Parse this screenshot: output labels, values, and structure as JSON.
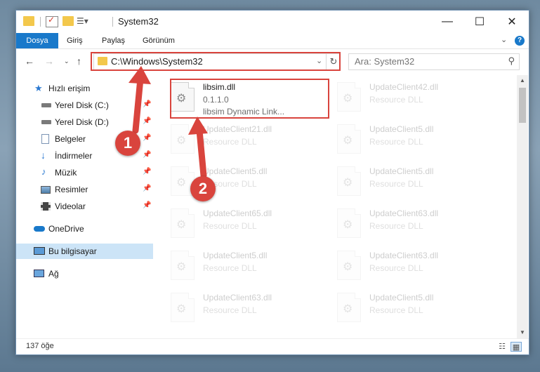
{
  "window": {
    "title": "System32",
    "controls": {
      "minimize": "—",
      "maximize": "☐",
      "close": "✕"
    }
  },
  "ribbon": {
    "tabs": [
      "Dosya",
      "Giriş",
      "Paylaş",
      "Görünüm"
    ],
    "help": "?"
  },
  "address": {
    "path": "C:\\Windows\\System32"
  },
  "search": {
    "placeholder": "Ara: System32"
  },
  "sidebar": {
    "items": [
      {
        "label": "Hızlı erişim",
        "icon": "star-icon"
      },
      {
        "label": "Yerel Disk (C:)",
        "icon": "drive-icon"
      },
      {
        "label": "Yerel Disk (D:)",
        "icon": "drive-icon"
      },
      {
        "label": "Belgeler",
        "icon": "documents-icon"
      },
      {
        "label": "İndirmeler",
        "icon": "download-icon"
      },
      {
        "label": "Müzik",
        "icon": "music-icon"
      },
      {
        "label": "Resimler",
        "icon": "pictures-icon"
      },
      {
        "label": "Videolar",
        "icon": "videos-icon"
      },
      {
        "label": "OneDrive",
        "icon": "cloud-icon"
      },
      {
        "label": "Bu bilgisayar",
        "icon": "computer-icon"
      },
      {
        "label": "Ağ",
        "icon": "network-icon"
      }
    ]
  },
  "files": {
    "featured": {
      "name": "libsim.dll",
      "version": "0.1.1.0",
      "description": "libsim Dynamic Link..."
    },
    "left_column": [
      {
        "name": "UpdateClient21.dll",
        "type": "Resource DLL"
      },
      {
        "name": "UpdateClient5.dll",
        "type": "Resource DLL"
      },
      {
        "name": "UpdateClient65.dll",
        "type": "Resource DLL"
      },
      {
        "name": "UpdateClient5.dll",
        "type": "Resource DLL"
      },
      {
        "name": "UpdateClient63.dll",
        "type": "Resource DLL"
      }
    ],
    "right_column": [
      {
        "name": "UpdateClient42.dll",
        "type": "Resource DLL"
      },
      {
        "name": "UpdateClient5.dll",
        "type": "Resource DLL"
      },
      {
        "name": "UpdateClient5.dll",
        "type": "Resource DLL"
      },
      {
        "name": "UpdateClient63.dll",
        "type": "Resource DLL"
      },
      {
        "name": "UpdateClient63.dll",
        "type": "Resource DLL"
      },
      {
        "name": "UpdateClient5.dll",
        "type": "Resource DLL"
      }
    ]
  },
  "status": {
    "count": "137 öğe"
  },
  "callouts": [
    "1",
    "2"
  ],
  "colors": {
    "accent": "#1979ca",
    "highlight": "#d9443d",
    "selected": "#cce4f7"
  }
}
